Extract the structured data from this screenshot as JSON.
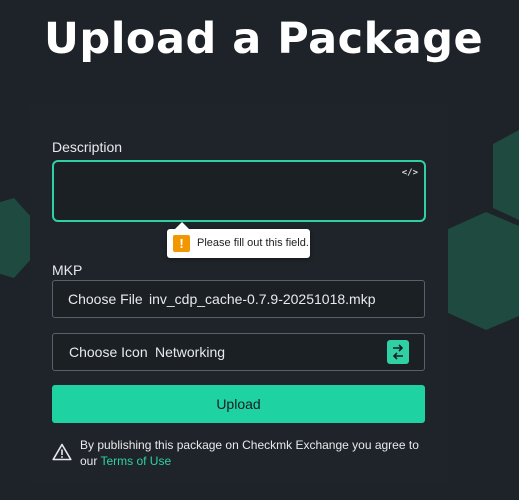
{
  "page": {
    "title": "Upload a Package"
  },
  "form": {
    "description_label": "Description",
    "description_value": "",
    "validation_message": "Please fill out this field.",
    "mkp_label": "MKP",
    "file_button_label": "Choose File",
    "file_name": "inv_cdp_cache-0.7.9-20251018.mkp",
    "icon_button_label": "Choose Icon",
    "icon_value": "Networking",
    "upload_label": "Upload"
  },
  "notice": {
    "text": "By publishing this package on Checkmk Exchange you agree to our ",
    "link_text": "Terms of Use"
  },
  "icons": {
    "code": "code-icon",
    "warning": "warning-icon",
    "swap": "swap-icon",
    "exclamation": "exclamation-icon"
  },
  "colors": {
    "background": "#1e2329",
    "accent": "#1ed2a2",
    "hexagon": "#1e4a3f",
    "tooltip_warning": "#f29700"
  }
}
